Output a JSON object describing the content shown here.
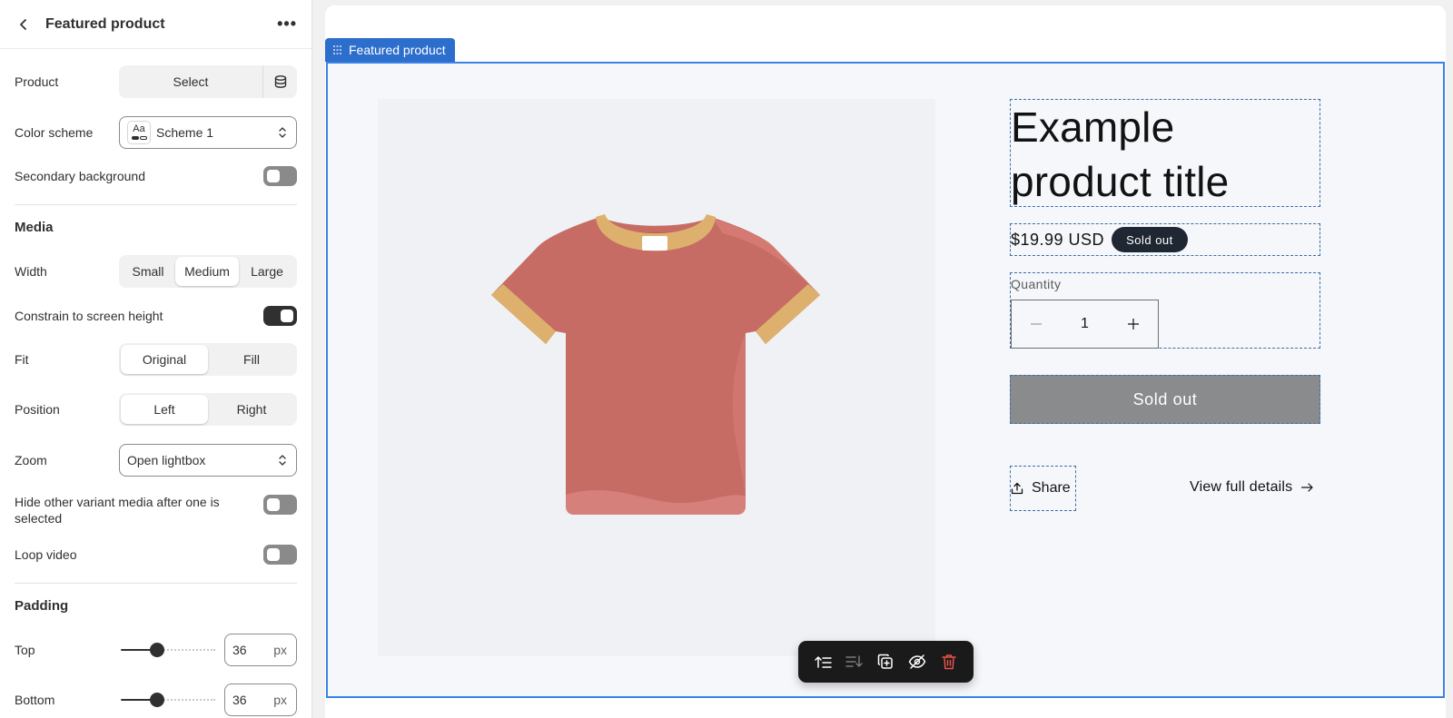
{
  "sidebar": {
    "title": "Featured product",
    "more": "•••",
    "product_label": "Product",
    "product_select": "Select",
    "color_scheme_label": "Color scheme",
    "color_scheme_icon_text": "Aa",
    "color_scheme_value": "Scheme 1",
    "secondary_bg_label": "Secondary background",
    "secondary_bg_on": false,
    "media_heading": "Media",
    "width_label": "Width",
    "width_options": [
      "Small",
      "Medium",
      "Large"
    ],
    "width_selected": "Medium",
    "constrain_label": "Constrain to screen height",
    "constrain_on": true,
    "fit_label": "Fit",
    "fit_options": [
      "Original",
      "Fill"
    ],
    "fit_selected": "Original",
    "position_label": "Position",
    "position_options": [
      "Left",
      "Right"
    ],
    "position_selected": "Left",
    "zoom_label": "Zoom",
    "zoom_value": "Open lightbox",
    "hide_variant_label": "Hide other variant media after one is selected",
    "hide_variant_on": false,
    "loop_video_label": "Loop video",
    "loop_video_on": false,
    "padding_heading": "Padding",
    "top_label": "Top",
    "top_value": "36",
    "bottom_label": "Bottom",
    "bottom_value": "36",
    "unit": "px"
  },
  "preview": {
    "section_tag": "Featured product",
    "product_title": "Example product title",
    "price": "$19.99 USD",
    "badge": "Sold out",
    "quantity_label": "Quantity",
    "quantity_value": "1",
    "sold_out_button": "Sold out",
    "share_label": "Share",
    "view_full_details": "View full details"
  },
  "colors": {
    "accent": "#2c6ecb",
    "section_border": "#3b82e6",
    "tshirt_body": "#c76b65",
    "tshirt_trim": "#ddb06d",
    "sold_out_bg": "#8a8b8d",
    "badge_bg": "#1f2732"
  }
}
